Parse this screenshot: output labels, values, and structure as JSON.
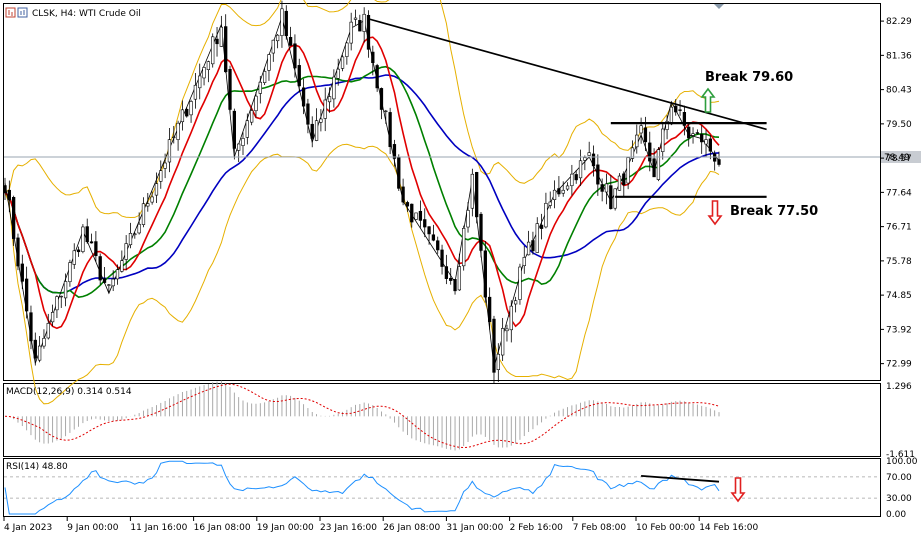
{
  "header": {
    "title": "CLSK, H4:  WTI Crude Oil"
  },
  "main_pane": {
    "price_ticks": [
      "82.29",
      "81.36",
      "80.43",
      "79.50",
      "78.57",
      "77.64",
      "76.71",
      "75.78",
      "74.85",
      "73.92",
      "72.99"
    ],
    "current_price": "78.49",
    "annotations": {
      "break_up": "Break 79.60",
      "break_down": "Break 77.50"
    }
  },
  "macd_pane": {
    "label": "MACD(12,26,9) 0.314 0.514",
    "ticks": [
      "1.296",
      "-1.611"
    ]
  },
  "rsi_pane": {
    "label": "RSI(14) 48.80",
    "ticks": [
      "100.00",
      "70.00",
      "30.00",
      "0.00"
    ]
  },
  "time_ticks": [
    "4 Jan 2023",
    "9 Jan 00:00",
    "11 Jan 16:00",
    "16 Jan 08:00",
    "19 Jan 00:00",
    "23 Jan 16:00",
    "26 Jan 08:00",
    "31 Jan 00:00",
    "2 Feb 16:00",
    "7 Feb 08:00",
    "10 Feb 00:00",
    "14 Feb 16:00"
  ],
  "colors": {
    "bull_candle": "#ffffff",
    "bear_candle": "#000000",
    "ma_fast": "#e00000",
    "ma_mid": "#008000",
    "ma_slow": "#0000c0",
    "bollinger": "#e6b000",
    "macd_hist": "#a0a0a0",
    "macd_signal": "#e00000",
    "rsi_line": "#1e90ff",
    "arrow_up": "#2e9e3e",
    "arrow_down": "#e02020"
  },
  "chart_data": {
    "type": "candlestick",
    "symbol": "CLSK",
    "timeframe": "H4",
    "instrument": "WTI Crude Oil",
    "y_range": [
      72.6,
      82.7
    ],
    "current_price": 78.49,
    "pivots": [
      {
        "bar": 0,
        "price": 77.9
      },
      {
        "bar": 7,
        "price": 73.0
      },
      {
        "bar": 18,
        "price": 76.6
      },
      {
        "bar": 24,
        "price": 74.9
      },
      {
        "bar": 50,
        "price": 82.2
      },
      {
        "bar": 53,
        "price": 78.6
      },
      {
        "bar": 64,
        "price": 82.4
      },
      {
        "bar": 71,
        "price": 79.0
      },
      {
        "bar": 80,
        "price": 82.1
      },
      {
        "bar": 83,
        "price": 82.3
      },
      {
        "bar": 92,
        "price": 77.4
      },
      {
        "bar": 104,
        "price": 75.2
      },
      {
        "bar": 108,
        "price": 78.0
      },
      {
        "bar": 113,
        "price": 72.9
      },
      {
        "bar": 120,
        "price": 75.8
      },
      {
        "bar": 127,
        "price": 77.6
      },
      {
        "bar": 135,
        "price": 78.6
      },
      {
        "bar": 140,
        "price": 77.4
      },
      {
        "bar": 143,
        "price": 78.1
      },
      {
        "bar": 147,
        "price": 79.2
      },
      {
        "bar": 150,
        "price": 78.2
      },
      {
        "bar": 154,
        "price": 80.1
      },
      {
        "bar": 158,
        "price": 79.2
      },
      {
        "bar": 161,
        "price": 79.1
      },
      {
        "bar": 165,
        "price": 78.5
      }
    ],
    "trendlines": [
      {
        "from": {
          "bar": 84,
          "price": 82.35
        },
        "to": {
          "bar": 176,
          "price": 79.35
        }
      },
      {
        "from": {
          "bar": 140,
          "price": 79.52
        },
        "to": {
          "bar": 176,
          "price": 79.52
        }
      },
      {
        "from": {
          "bar": 141,
          "price": 77.52
        },
        "to": {
          "bar": 176,
          "price": 77.52
        }
      }
    ],
    "macd": {
      "params": "12,26,9",
      "main": 0.314,
      "signal": 0.514,
      "y_range": [
        -1.611,
        1.296
      ]
    },
    "rsi": {
      "period": 14,
      "value": 48.8,
      "levels": [
        70,
        30
      ],
      "y_range": [
        0,
        100
      ]
    }
  }
}
